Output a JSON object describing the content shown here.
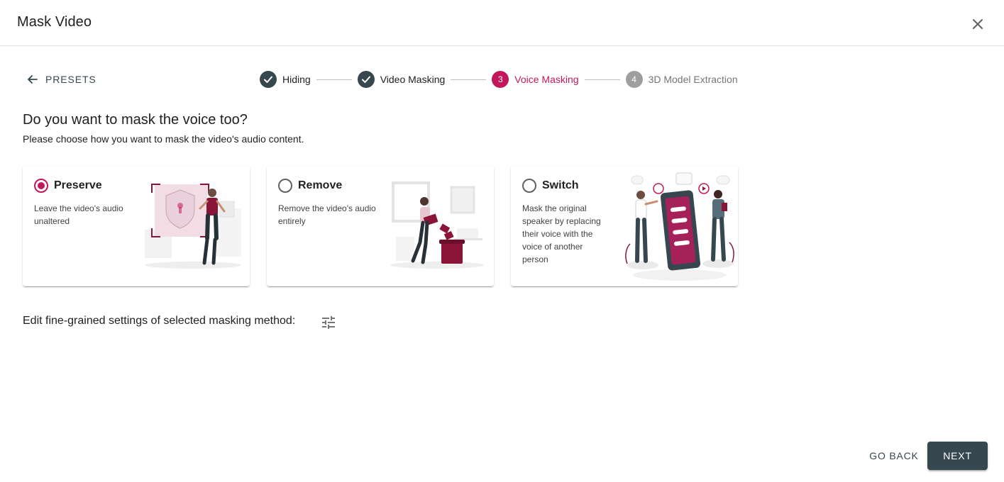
{
  "dialog": {
    "title": "Mask Video"
  },
  "nav": {
    "presets_label": "PRESETS"
  },
  "stepper": {
    "steps": [
      {
        "label": "Hiding",
        "state": "completed"
      },
      {
        "label": "Video Masking",
        "state": "completed"
      },
      {
        "number": "3",
        "label": "Voice Masking",
        "state": "active"
      },
      {
        "number": "4",
        "label": "3D Model Extraction",
        "state": "pending"
      }
    ]
  },
  "content": {
    "question": "Do you want to mask the voice too?",
    "subtext": "Please choose how you want to mask the video's audio content."
  },
  "options": [
    {
      "title": "Preserve",
      "description": "Leave the video's audio unaltered",
      "selected": true
    },
    {
      "title": "Remove",
      "description": "Remove the video's audio entirely",
      "selected": false
    },
    {
      "title": "Switch",
      "description": "Mask the original speaker by replacing their voice with the voice of another person",
      "selected": false
    }
  ],
  "fine_grained": {
    "label": "Edit fine-grained settings of selected masking method:",
    "icon": "tune-icon"
  },
  "actions": {
    "go_back": "GO BACK",
    "next": "NEXT"
  },
  "colors": {
    "accent": "#c2185b",
    "primary_dark": "#37474f",
    "pending": "#9e9e9e",
    "illustration_accent": "#8a1538"
  }
}
